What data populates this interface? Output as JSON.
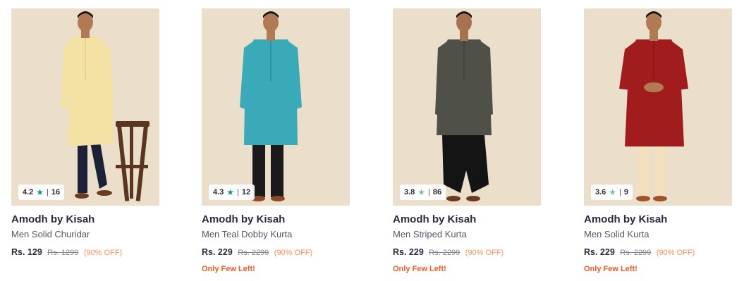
{
  "products": [
    {
      "brand": "Amodh by Kisah",
      "name": "Men Solid Churidar",
      "price": "Rs. 129",
      "mrp": "Rs. 1299",
      "discount": "(90% OFF)",
      "rating": "4.2",
      "rating_count": "16",
      "stock_note": "",
      "star_color": "#14958f",
      "garment_color": "#f3e2a4",
      "garment_icon": "cream-kurta-photo"
    },
    {
      "brand": "Amodh by Kisah",
      "name": "Men Teal Dobby Kurta",
      "price": "Rs. 229",
      "mrp": "Rs. 2299",
      "discount": "(90% OFF)",
      "rating": "4.3",
      "rating_count": "12",
      "stock_note": "Only Few Left!",
      "star_color": "#14958f",
      "garment_color": "#3aa9b8",
      "garment_icon": "teal-kurta-photo"
    },
    {
      "brand": "Amodh by Kisah",
      "name": "Men Striped Kurta",
      "price": "Rs. 229",
      "mrp": "Rs. 2299",
      "discount": "(90% OFF)",
      "rating": "3.8",
      "rating_count": "86",
      "stock_note": "Only Few Left!",
      "star_color": "#72bfbc",
      "garment_color": "#4f5047",
      "garment_icon": "grey-kurta-photo"
    },
    {
      "brand": "Amodh by Kisah",
      "name": "Men Solid Kurta",
      "price": "Rs. 229",
      "mrp": "Rs. 2299",
      "discount": "(90% OFF)",
      "rating": "3.6",
      "rating_count": "9",
      "stock_note": "Only Few Left!",
      "star_color": "#72bfbc",
      "garment_color": "#a11c1c",
      "garment_icon": "maroon-kurta-photo"
    }
  ]
}
